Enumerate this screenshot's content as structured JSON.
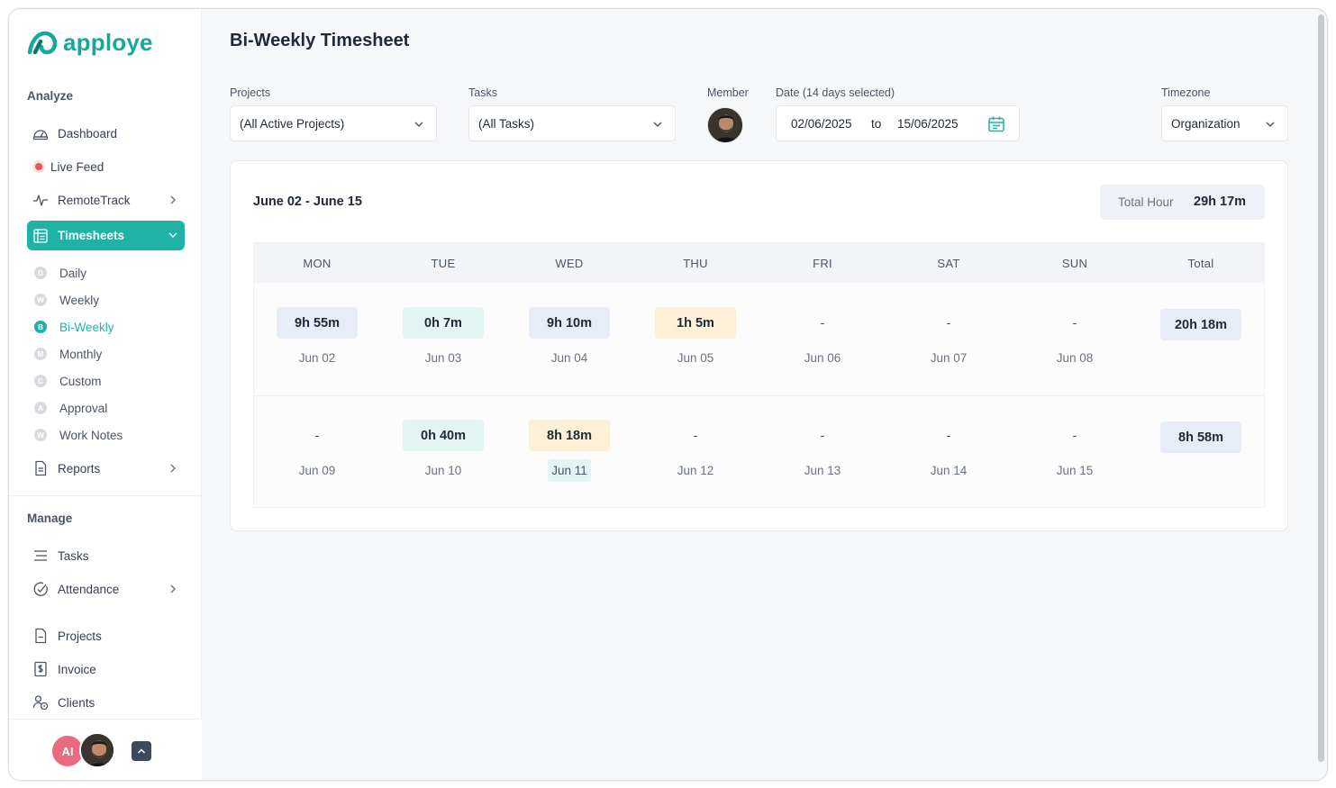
{
  "app": {
    "name": "apploye"
  },
  "sidebar": {
    "analyze_title": "Analyze",
    "analyze_items": [
      {
        "label": "Dashboard",
        "icon": "dashboard-icon"
      },
      {
        "label": "Live Feed",
        "icon": "live-dot-icon"
      },
      {
        "label": "RemoteTrack",
        "icon": "activity-icon"
      },
      {
        "label": "Timesheets",
        "icon": "timesheet-icon"
      }
    ],
    "timesheet_sub": [
      {
        "badge": "D",
        "label": "Daily"
      },
      {
        "badge": "W",
        "label": "Weekly"
      },
      {
        "badge": "B",
        "label": "Bi-Weekly"
      },
      {
        "badge": "M",
        "label": "Monthly"
      },
      {
        "badge": "C",
        "label": "Custom"
      },
      {
        "badge": "A",
        "label": "Approval"
      },
      {
        "badge": "W",
        "label": "Work Notes"
      }
    ],
    "reports_label": "Reports",
    "manage_title": "Manage",
    "manage_items": [
      {
        "label": "Tasks",
        "icon": "tasks-icon"
      },
      {
        "label": "Attendance",
        "icon": "attendance-icon"
      },
      {
        "label": "Projects",
        "icon": "projects-icon"
      },
      {
        "label": "Invoice",
        "icon": "invoice-icon"
      },
      {
        "label": "Clients",
        "icon": "clients-icon"
      }
    ],
    "footer_initials": "AI"
  },
  "header": {
    "title": "Bi-Weekly Timesheet"
  },
  "filters": {
    "projects_label": "Projects",
    "projects_value": "(All Active Projects)",
    "tasks_label": "Tasks",
    "tasks_value": "(All Tasks)",
    "member_label": "Member",
    "date_label": "Date (14 days selected)",
    "date_from": "02/06/2025",
    "date_to_word": "to",
    "date_to": "15/06/2025",
    "timezone_label": "Timezone",
    "timezone_value": "Organization"
  },
  "timesheet": {
    "range": "June 02 - June 15",
    "total_label": "Total Hour",
    "total_value": "29h 17m",
    "columns": [
      "MON",
      "TUE",
      "WED",
      "THU",
      "FRI",
      "SAT",
      "SUN",
      "Total"
    ],
    "weeks": [
      {
        "days": [
          {
            "hours": "9h 55m",
            "date": "Jun 02"
          },
          {
            "hours": "0h 7m",
            "date": "Jun 03"
          },
          {
            "hours": "9h 10m",
            "date": "Jun 04"
          },
          {
            "hours": "1h 5m",
            "date": "Jun 05"
          },
          {
            "hours": "-",
            "date": "Jun 06"
          },
          {
            "hours": "-",
            "date": "Jun 07"
          },
          {
            "hours": "-",
            "date": "Jun 08"
          }
        ],
        "total": "20h 18m"
      },
      {
        "days": [
          {
            "hours": "-",
            "date": "Jun 09"
          },
          {
            "hours": "0h 40m",
            "date": "Jun 10"
          },
          {
            "hours": "8h 18m",
            "date": "Jun 11"
          },
          {
            "hours": "-",
            "date": "Jun 12"
          },
          {
            "hours": "-",
            "date": "Jun 13"
          },
          {
            "hours": "-",
            "date": "Jun 14"
          },
          {
            "hours": "-",
            "date": "Jun 15"
          }
        ],
        "total": "8h 58m"
      }
    ]
  },
  "colors": {
    "accent": "#1fb2a6",
    "live": "#f05252",
    "avatar_ai": "#ec6a80"
  }
}
